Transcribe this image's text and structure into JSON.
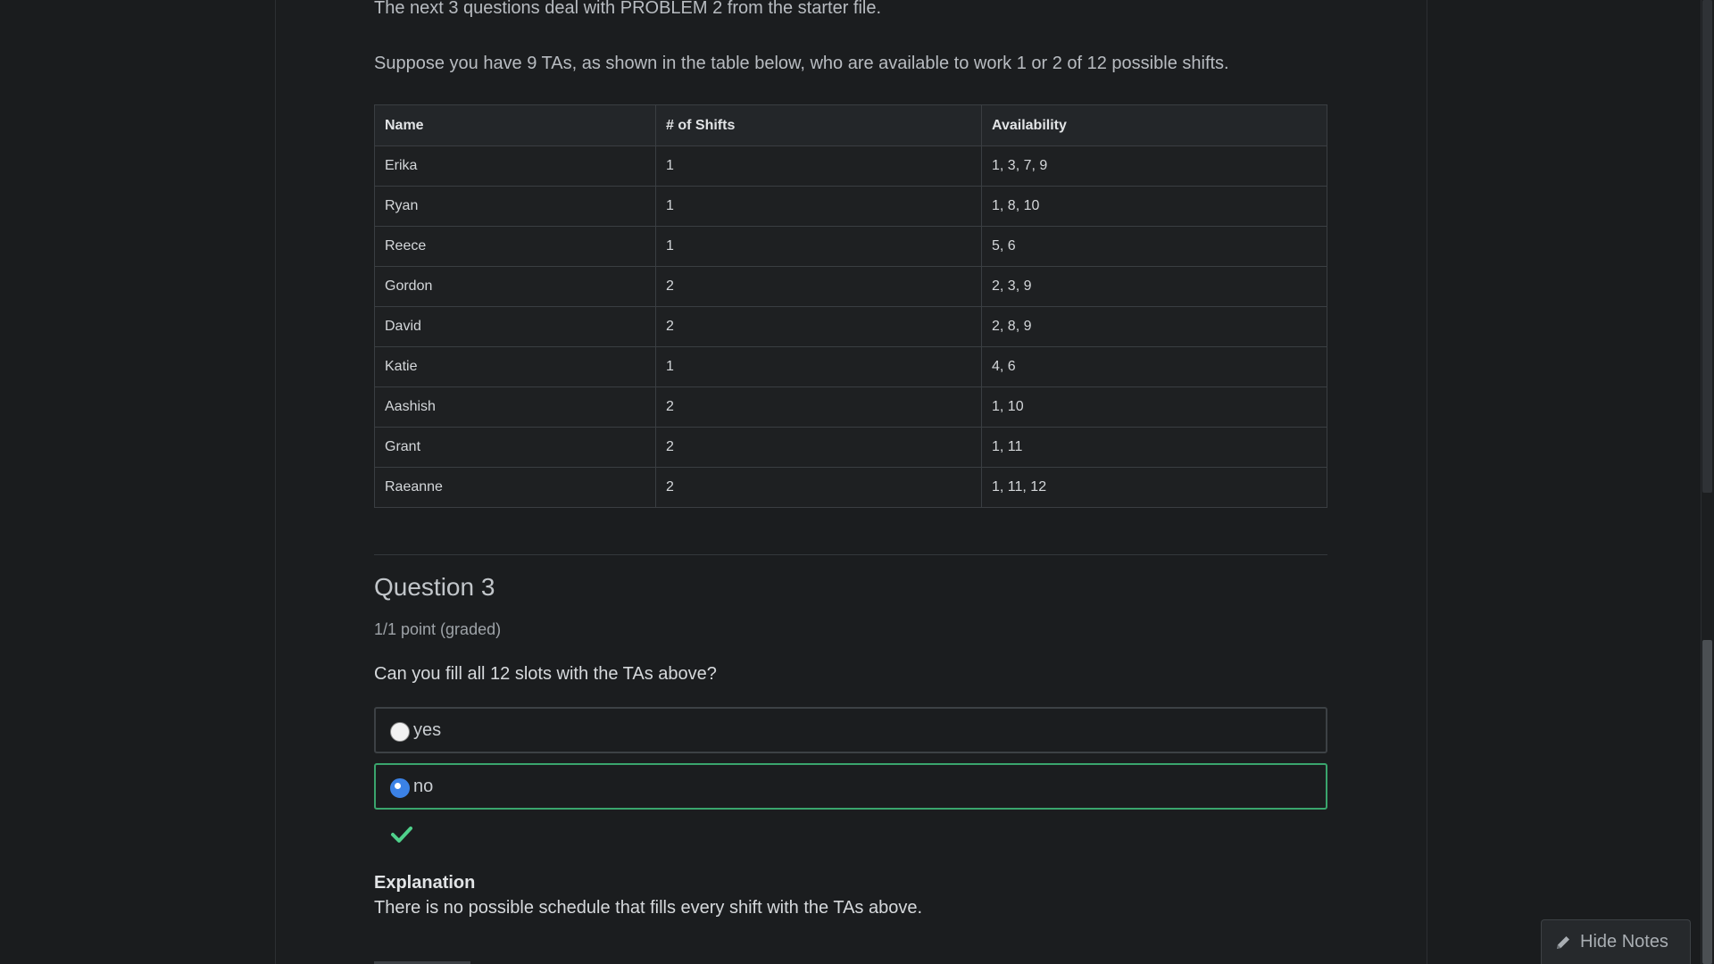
{
  "intro": {
    "line1": "The next 3 questions deal with PROBLEM 2 from the starter file.",
    "line2": "Suppose you have 9 TAs, as shown in the table below, who are available to work 1 or 2 of 12 possible shifts."
  },
  "table": {
    "headers": [
      "Name",
      "# of Shifts",
      "Availability"
    ],
    "rows": [
      [
        "Erika",
        "1",
        "1, 3, 7, 9"
      ],
      [
        "Ryan",
        "1",
        "1, 8, 10"
      ],
      [
        "Reece",
        "1",
        "5, 6"
      ],
      [
        "Gordon",
        "2",
        "2, 3, 9"
      ],
      [
        "David",
        "2",
        "2, 8, 9"
      ],
      [
        "Katie",
        "1",
        "4, 6"
      ],
      [
        "Aashish",
        "2",
        "1, 10"
      ],
      [
        "Grant",
        "2",
        "1, 11"
      ],
      [
        "Raeanne",
        "2",
        "1, 11, 12"
      ]
    ]
  },
  "question": {
    "title": "Question 3",
    "points": "1/1 point (graded)",
    "prompt": "Can you fill all 12 slots with the TAs above?",
    "options": [
      {
        "label": "yes",
        "selected": false
      },
      {
        "label": "no",
        "selected": true
      }
    ],
    "result_icon": "checkmark-icon",
    "explanation_title": "Explanation",
    "explanation_text": "There is no possible schedule that fills every shift with the TAs above."
  },
  "notes_button": {
    "label": "Hide Notes",
    "icon": "pencil-icon"
  },
  "colors": {
    "correct_border": "#3aa56d",
    "checkmark": "#4fd18b",
    "radio_selected": "#3b82e6"
  }
}
